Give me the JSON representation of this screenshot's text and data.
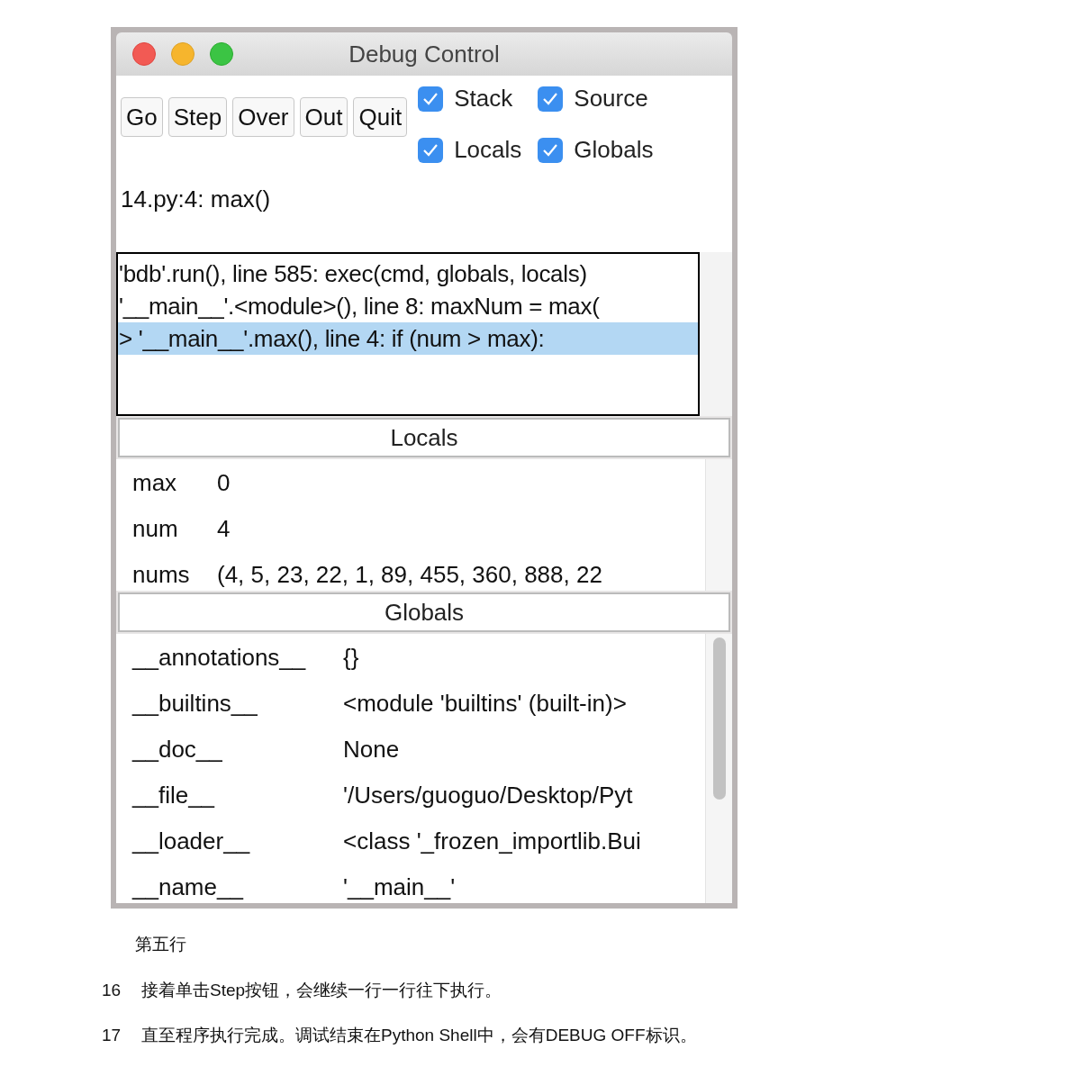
{
  "window": {
    "title": "Debug Control"
  },
  "buttons": [
    "Go",
    "Step",
    "Over",
    "Out",
    "Quit"
  ],
  "checkboxes": [
    {
      "label": "Stack",
      "checked": true
    },
    {
      "label": "Source",
      "checked": true
    },
    {
      "label": "Locals",
      "checked": true
    },
    {
      "label": "Globals",
      "checked": true
    }
  ],
  "status": "14.py:4: max()",
  "stack": [
    {
      "text": "'bdb'.run(), line 585: exec(cmd, globals, locals)",
      "selected": false
    },
    {
      "text": "'__main__'.<module>(), line 8: maxNum = max(",
      "selected": false
    },
    {
      "text": "> '__main__'.max(), line 4: if (num > max):",
      "selected": true
    }
  ],
  "locals": {
    "title": "Locals",
    "rows": [
      {
        "name": "max",
        "value": "0"
      },
      {
        "name": "num",
        "value": "4"
      },
      {
        "name": "nums",
        "value": "(4, 5, 23, 22, 1, 89, 455, 360, 888, 22"
      }
    ]
  },
  "globals": {
    "title": "Globals",
    "rows": [
      {
        "name": "__annotations__",
        "value": "{}"
      },
      {
        "name": "__builtins__",
        "value": "<module 'builtins' (built-in)>"
      },
      {
        "name": "__doc__",
        "value": "None"
      },
      {
        "name": "__file__",
        "value": "'/Users/guoguo/Desktop/Pyt"
      },
      {
        "name": "__loader__",
        "value": "<class '_frozen_importlib.Bui"
      },
      {
        "name": "__name__",
        "value": "'__main__'"
      }
    ]
  },
  "caption": "第五行",
  "steps": [
    {
      "number": "16",
      "text": "接着单击Step按钮，会继续一行一行往下执行。"
    },
    {
      "number": "17",
      "text": "直至程序执行完成。调试结束在Python Shell中，会有DEBUG OFF标识。"
    }
  ]
}
